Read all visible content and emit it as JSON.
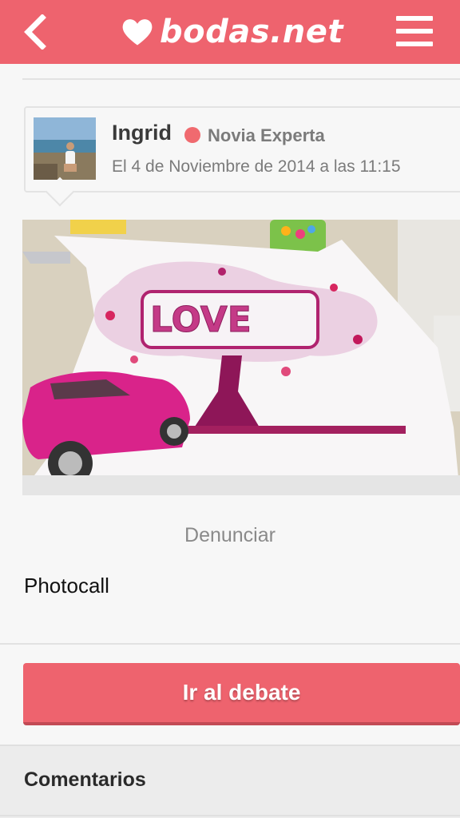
{
  "header": {
    "logo_text": "bodas.net",
    "back_icon": "chevron-left-icon",
    "menu_icon": "hamburger-menu-icon",
    "brand_color": "#ee636e"
  },
  "post": {
    "author": {
      "name": "Ingrid",
      "role": "Novia Experta",
      "status_color": "#f06a6f",
      "date": "El 4 de Noviembre de 2014 a las 11:15"
    },
    "report_label": "Denunciar",
    "title": "Photocall",
    "debate_button_label": "Ir al debate"
  },
  "comments": {
    "heading": "Comentarios"
  }
}
